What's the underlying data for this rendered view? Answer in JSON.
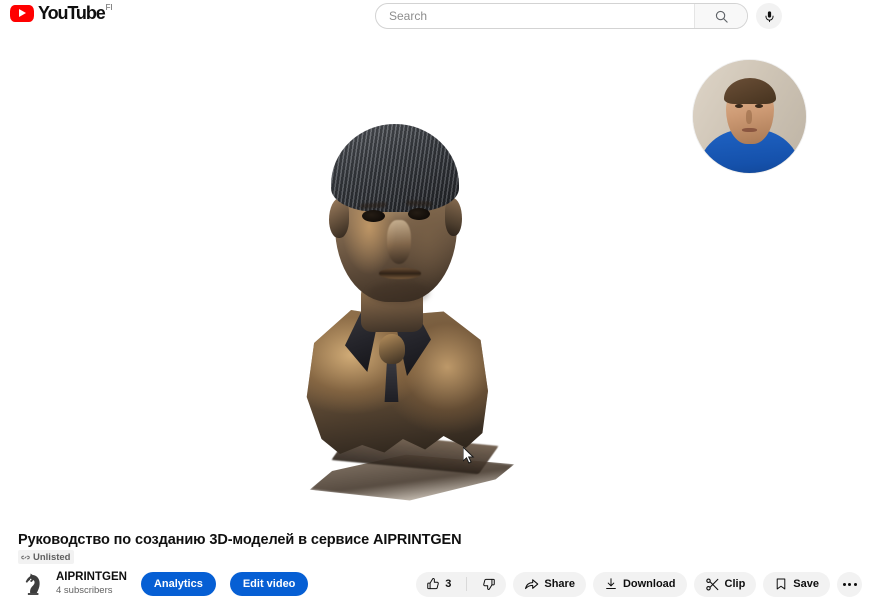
{
  "header": {
    "logo_text": "YouTube",
    "logo_country": "FI",
    "logo_icon": "youtube-play-icon",
    "search": {
      "placeholder": "Search",
      "value": "",
      "submit_icon": "search-icon"
    },
    "voice_search_icon": "microphone-icon"
  },
  "player": {
    "content_description": "3D scanned bronze bust of a man on white background",
    "webcam_overlay_description": "circular webcam bubble showing person in blue shirt",
    "cursor_icon": "mouse-pointer-icon"
  },
  "video": {
    "title": "Руководство по созданию 3D-моделей в сервисе AIPRINTGEN",
    "visibility_badge": {
      "label": "Unlisted",
      "icon": "link-icon"
    }
  },
  "channel": {
    "avatar_icon": "chess-knight-avatar",
    "name": "AIPRINTGEN",
    "subscribers": "4 subscribers",
    "analytics_label": "Analytics",
    "edit_video_label": "Edit video"
  },
  "actions": {
    "like": {
      "label": "3",
      "icon": "thumbs-up-icon"
    },
    "dislike": {
      "label": "",
      "icon": "thumbs-down-icon"
    },
    "share": {
      "label": "Share",
      "icon": "share-arrow-icon"
    },
    "download": {
      "label": "Download",
      "icon": "download-icon"
    },
    "clip": {
      "label": "Clip",
      "icon": "scissors-icon"
    },
    "save": {
      "label": "Save",
      "icon": "bookmark-icon"
    },
    "more": {
      "label": "",
      "icon": "more-horizontal-icon"
    }
  },
  "colors": {
    "brand_red": "#ff0000",
    "accent_blue": "#065fd4",
    "pill_gray": "#f2f2f2",
    "text_primary": "#0f0f0f",
    "text_secondary": "#606060"
  }
}
